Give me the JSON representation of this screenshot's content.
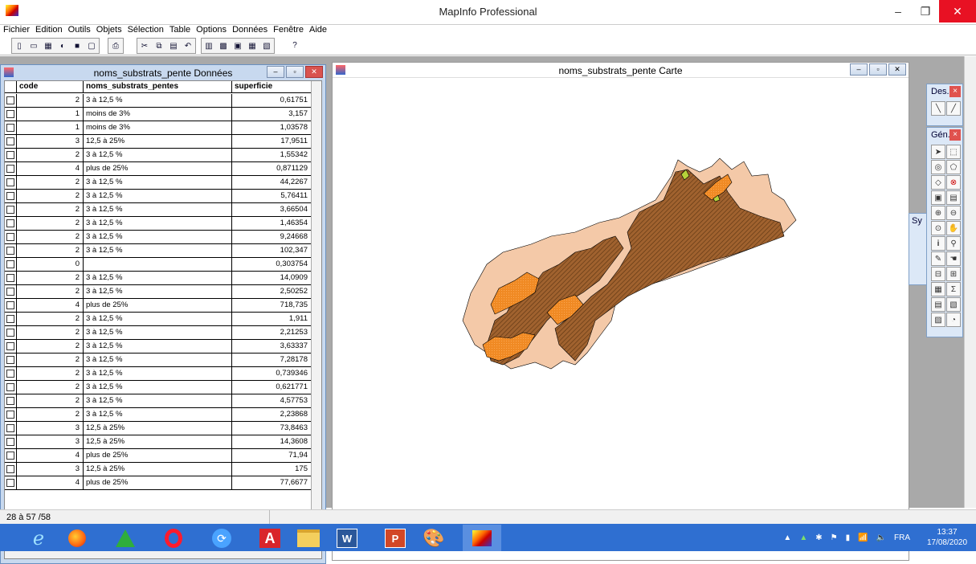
{
  "window": {
    "title": "MapInfo Professional",
    "minimize": "–",
    "restore": "❐",
    "close": "✕"
  },
  "menu": [
    "Fichier",
    "Edition",
    "Outils",
    "Objets",
    "Sélection",
    "Table",
    "Options",
    "Données",
    "Fenêtre",
    "Aide"
  ],
  "toolbar": {
    "help_icon": "?"
  },
  "data_window": {
    "title": "noms_substrats_pente Données",
    "columns": [
      "code",
      "noms_substrats_pentes",
      "superficie"
    ],
    "rows": [
      [
        "2",
        "3 à 12,5 %",
        "0,61751"
      ],
      [
        "1",
        "moins de 3%",
        "3,157"
      ],
      [
        "1",
        "moins de 3%",
        "1,03578"
      ],
      [
        "3",
        "12,5 à 25%",
        "17,9511"
      ],
      [
        "2",
        "3 à 12,5 %",
        "1,55342"
      ],
      [
        "4",
        "plus de 25%",
        "0,871129"
      ],
      [
        "2",
        "3 à 12,5 %",
        "44,2267"
      ],
      [
        "2",
        "3 à 12,5 %",
        "5,76411"
      ],
      [
        "2",
        "3 à 12,5 %",
        "3,66504"
      ],
      [
        "2",
        "3 à 12,5 %",
        "1,46354"
      ],
      [
        "2",
        "3 à 12,5 %",
        "9,24668"
      ],
      [
        "2",
        "3 à 12,5 %",
        "102,347"
      ],
      [
        "0",
        "",
        "0,303754"
      ],
      [
        "2",
        "3 à 12,5 %",
        "14,0909"
      ],
      [
        "2",
        "3 à 12,5 %",
        "2,50252"
      ],
      [
        "4",
        "plus de 25%",
        "718,735"
      ],
      [
        "2",
        "3 à 12,5 %",
        "1,911"
      ],
      [
        "2",
        "3 à 12,5 %",
        "2,21253"
      ],
      [
        "2",
        "3 à 12,5 %",
        "3,63337"
      ],
      [
        "2",
        "3 à 12,5 %",
        "7,28178"
      ],
      [
        "2",
        "3 à 12,5 %",
        "0,739346"
      ],
      [
        "2",
        "3 à 12,5 %",
        "0,621771"
      ],
      [
        "2",
        "3 à 12,5 %",
        "4,57753"
      ],
      [
        "2",
        "3 à 12,5 %",
        "2,23868"
      ],
      [
        "3",
        "12,5 à 25%",
        "73,8463"
      ],
      [
        "3",
        "12,5 à 25%",
        "14,3608"
      ],
      [
        "4",
        "plus de 25%",
        "71,94"
      ],
      [
        "3",
        "12,5 à 25%",
        "175"
      ],
      [
        "4",
        "plus de 25%",
        "77,6677"
      ]
    ]
  },
  "map_window": {
    "title": "noms_substrats_pente Carte"
  },
  "tool_windows": {
    "drawing": "Des...",
    "general": "Gén...",
    "symbol": "Sy"
  },
  "status": {
    "record": "28 à 57 /58"
  },
  "taskbar": {
    "lang": "FRA",
    "time": "13:37",
    "date": "17/08/2020"
  },
  "colors": {
    "fill_slope_high": "#a0622f",
    "fill_orange": "#f08a24",
    "fill_light": "#f4c9a8",
    "fill_green": "#b6d23a",
    "taskbar": "#2f6fd1"
  }
}
